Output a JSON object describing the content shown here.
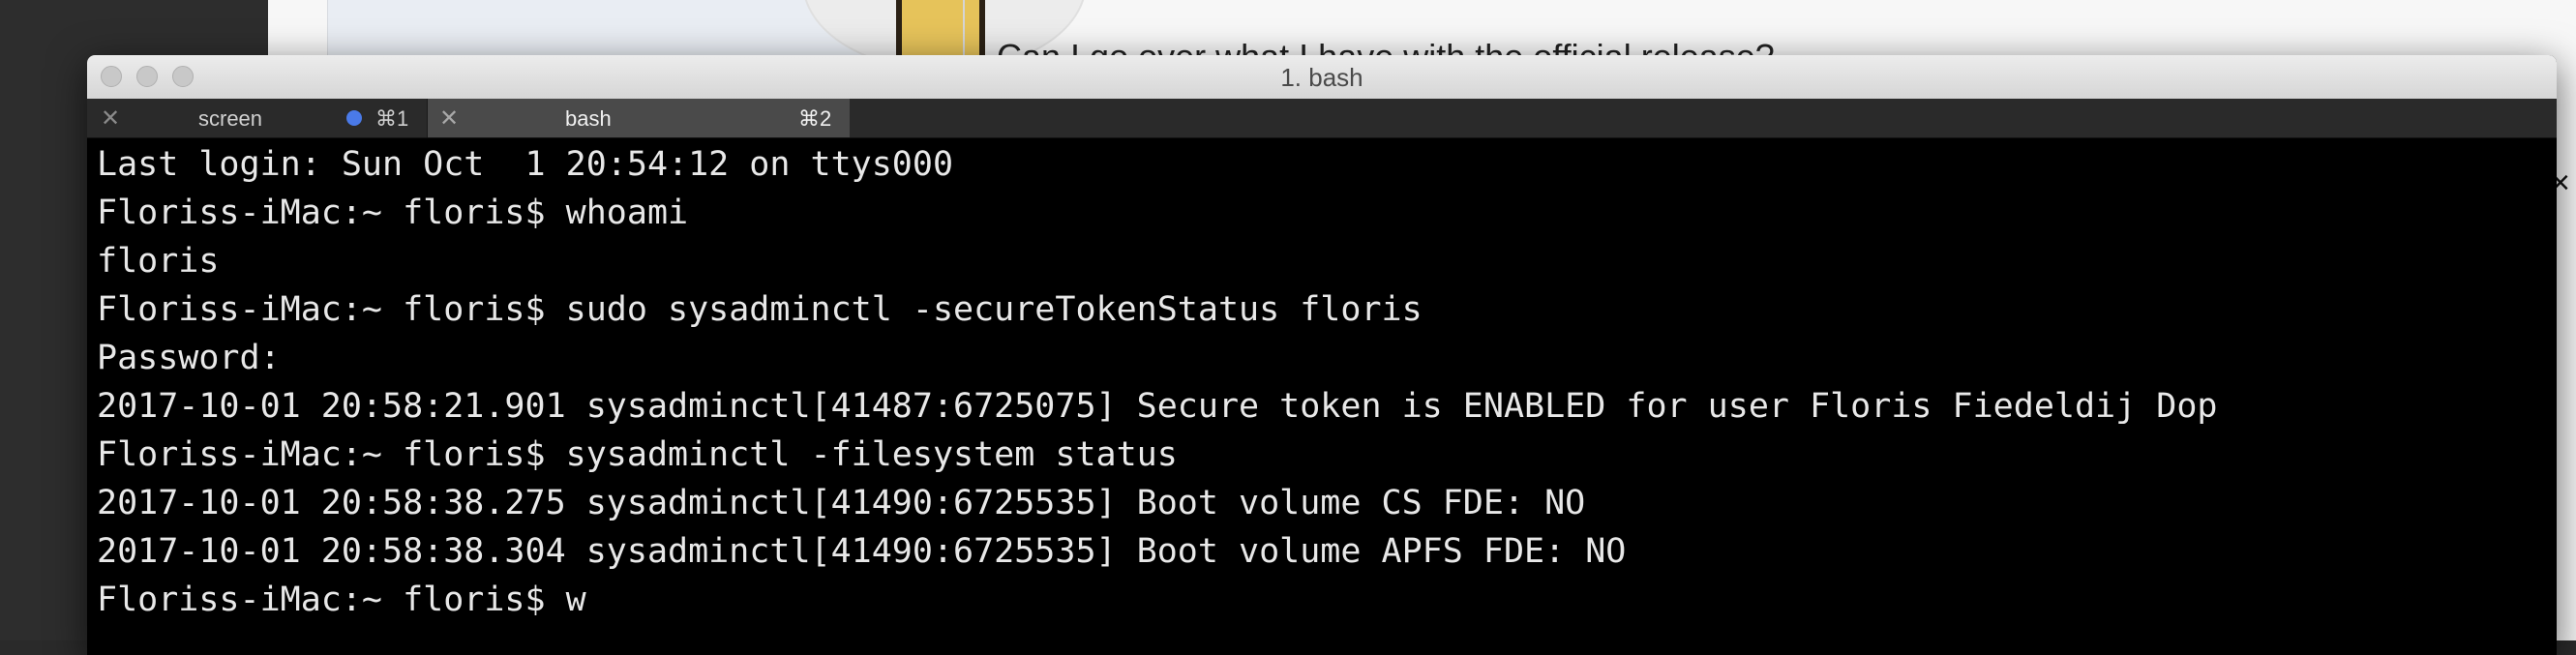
{
  "background": {
    "question_text": "Can I go over what I have with the official release?",
    "close_glyph": "×"
  },
  "window": {
    "title": "1. bash"
  },
  "tabs": [
    {
      "label": "screen",
      "shortcut": "⌘1",
      "close_glyph": "✕",
      "has_activity_dot": true,
      "active": false
    },
    {
      "label": "bash",
      "shortcut": "⌘2",
      "close_glyph": "✕",
      "has_activity_dot": false,
      "active": true
    }
  ],
  "terminal": {
    "lines": [
      "Last login: Sun Oct  1 20:54:12 on ttys000",
      "Floriss-iMac:~ floris$ whoami",
      "floris",
      "Floriss-iMac:~ floris$ sudo sysadminctl -secureTokenStatus floris",
      "Password:",
      "2017-10-01 20:58:21.901 sysadminctl[41487:6725075] Secure token is ENABLED for user Floris Fiedeldij Dop",
      "Floriss-iMac:~ floris$ sysadminctl -filesystem status",
      "2017-10-01 20:58:38.275 sysadminctl[41490:6725535] Boot volume CS FDE: NO",
      "2017-10-01 20:58:38.304 sysadminctl[41490:6725535] Boot volume APFS FDE: NO",
      "Floriss-iMac:~ floris$ w"
    ]
  },
  "colors": {
    "terminal_bg": "#000000",
    "terminal_fg": "#e8e8e8",
    "tab_active_bg": "#4a4a4a",
    "activity_dot": "#4a7ae8"
  }
}
